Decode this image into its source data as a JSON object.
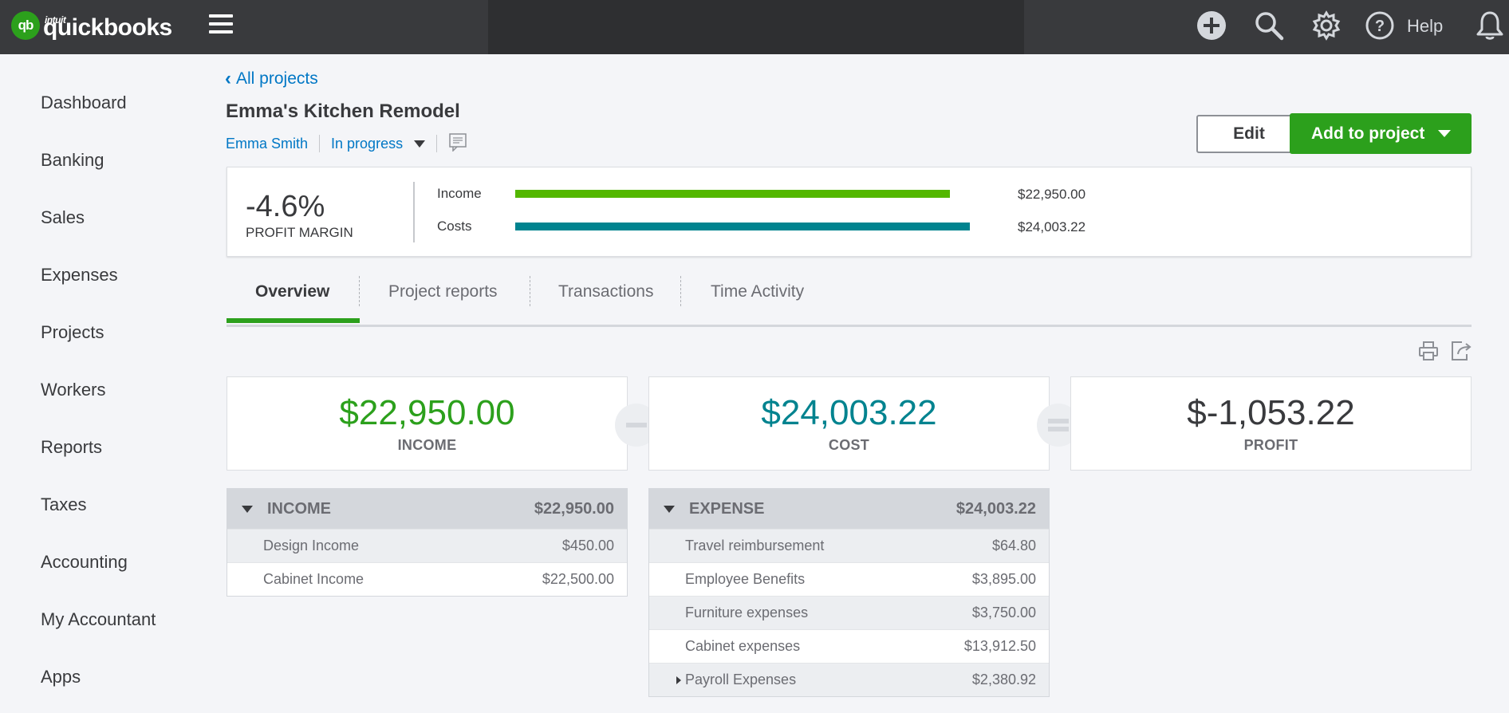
{
  "app": {
    "brand_small": "intuit",
    "brand": "quickbooks",
    "logo_mark": "qb",
    "help_label": "Help",
    "accent_color": "#2ca01c",
    "link_color": "#0077c5",
    "icons": [
      "plus-circle-icon",
      "search-icon",
      "gear-icon",
      "question-circle-icon",
      "bell-icon",
      "hamburger-menu-icon"
    ]
  },
  "sidebar": {
    "items": [
      {
        "label": "Dashboard"
      },
      {
        "label": "Banking"
      },
      {
        "label": "Sales"
      },
      {
        "label": "Expenses"
      },
      {
        "label": "Projects"
      },
      {
        "label": "Workers"
      },
      {
        "label": "Reports"
      },
      {
        "label": "Taxes"
      },
      {
        "label": "Accounting"
      },
      {
        "label": "My Accountant"
      },
      {
        "label": "Apps"
      }
    ]
  },
  "project": {
    "back_link": "All projects",
    "title": "Emma's Kitchen Remodel",
    "customer": "Emma Smith",
    "status": "In progress",
    "edit_label": "Edit",
    "add_label": "Add to project"
  },
  "profit_margin": {
    "value": "-4.6%",
    "label": "PROFIT MARGIN",
    "bars": [
      {
        "label": "Income",
        "amount": "$22,950.00",
        "value": 22950.0,
        "color": "#53b700"
      },
      {
        "label": "Costs",
        "amount": "$24,003.22",
        "value": 24003.22,
        "color": "#00838f"
      }
    ]
  },
  "tabs": [
    {
      "label": "Overview",
      "active": true
    },
    {
      "label": "Project reports",
      "active": false
    },
    {
      "label": "Transactions",
      "active": false
    },
    {
      "label": "Time Activity",
      "active": false
    }
  ],
  "summary": {
    "income": {
      "amount": "$22,950.00",
      "label": "INCOME",
      "color": "#2ca01c"
    },
    "cost": {
      "amount": "$24,003.22",
      "label": "COST",
      "color": "#00838f"
    },
    "profit": {
      "amount": "$-1,053.22",
      "label": "PROFIT",
      "color": "#393a3d"
    }
  },
  "income_table": {
    "title": "INCOME",
    "total": "$22,950.00",
    "rows": [
      {
        "name": "Design Income",
        "amount": "$450.00"
      },
      {
        "name": "Cabinet Income",
        "amount": "$22,500.00"
      }
    ]
  },
  "expense_table": {
    "title": "EXPENSE",
    "total": "$24,003.22",
    "rows": [
      {
        "name": "Travel reimbursement",
        "amount": "$64.80"
      },
      {
        "name": "Employee Benefits",
        "amount": "$3,895.00"
      },
      {
        "name": "Furniture expenses",
        "amount": "$3,750.00"
      },
      {
        "name": "Cabinet expenses",
        "amount": "$13,912.50"
      },
      {
        "name": "Payroll Expenses",
        "amount": "$2,380.92",
        "expandable": true
      }
    ]
  }
}
